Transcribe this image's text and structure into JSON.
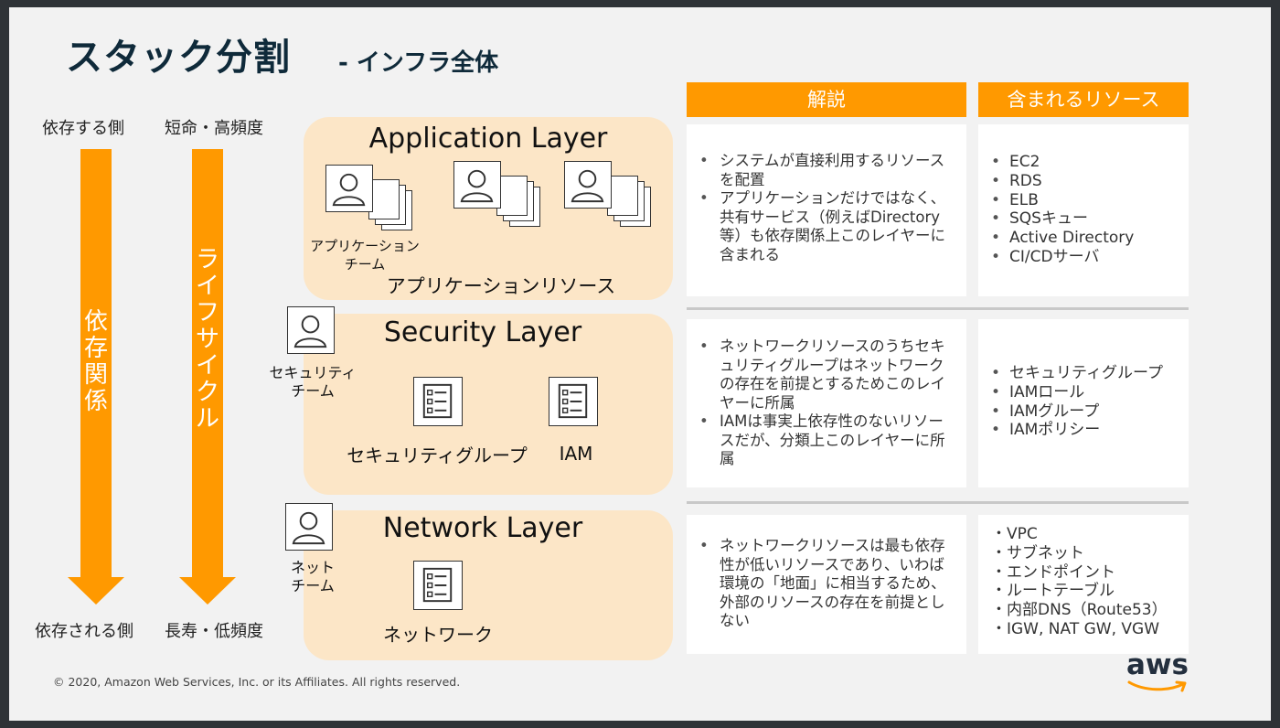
{
  "title": {
    "main": "スタック分割",
    "sub": "- インフラ全体"
  },
  "left_axis": {
    "dep_top": "依存する側",
    "life_top": "短命・高頻度",
    "dep_bottom": "依存される側",
    "life_bottom": "長寿・低頻度",
    "dep_arrow_text": [
      "依",
      "存",
      "関",
      "係"
    ],
    "life_arrow_text": [
      "ラ",
      "イ",
      "フ",
      "サ",
      "イ",
      "ク",
      "ル"
    ]
  },
  "layers": {
    "application": {
      "title": "Application Layer",
      "team_label_1": "アプリケーション",
      "team_label_2": "チーム",
      "resource_label": "アプリケーションリソース"
    },
    "security": {
      "title": "Security Layer",
      "team_label_1": "セキュリティ",
      "team_label_2": "チーム",
      "res1": "セキュリティグループ",
      "res2": "IAM"
    },
    "network": {
      "title": "Network Layer",
      "team_label_1": "ネット",
      "team_label_2": "チーム",
      "res1": "ネットワーク"
    }
  },
  "columns": {
    "explanation": "解説",
    "resources": "含まれるリソース"
  },
  "rows": [
    {
      "explanation": [
        "システムが直接利用するリソースを配置",
        "アプリケーションだけではなく、共有サービス（例えばDirectory等）も依存関係上このレイヤーに含まれる"
      ],
      "resources": [
        "EC2",
        "RDS",
        "ELB",
        "SQSキュー",
        "Active Directory",
        "CI/CDサーバ"
      ]
    },
    {
      "explanation": [
        "ネットワークリソースのうちセキュリティグループはネットワークの存在を前提とするためこのレイヤーに所属",
        "IAMは事実上依存性のないリソースだが、分類上このレイヤーに所属"
      ],
      "resources": [
        "セキュリティグループ",
        "IAMロール",
        "IAMグループ",
        "IAMポリシー"
      ]
    },
    {
      "explanation": [
        "ネットワークリソースは最も依存性が低いリソースであり、いわば環境の「地面」に相当するため、外部のリソースの存在を前提としない"
      ],
      "resources": [
        "・VPC",
        "・サブネット",
        "・エンドポイント",
        "・ルートテーブル",
        "・内部DNS（Route53）",
        "・IGW, NAT GW, VGW"
      ]
    }
  ],
  "footer": "© 2020, Amazon Web Services, Inc. or its Affiliates. All rights reserved.",
  "logo": "aws",
  "colors": {
    "accent": "#ff9900",
    "layer_bg": "#fce6c7",
    "title": "#0f2a3a"
  }
}
